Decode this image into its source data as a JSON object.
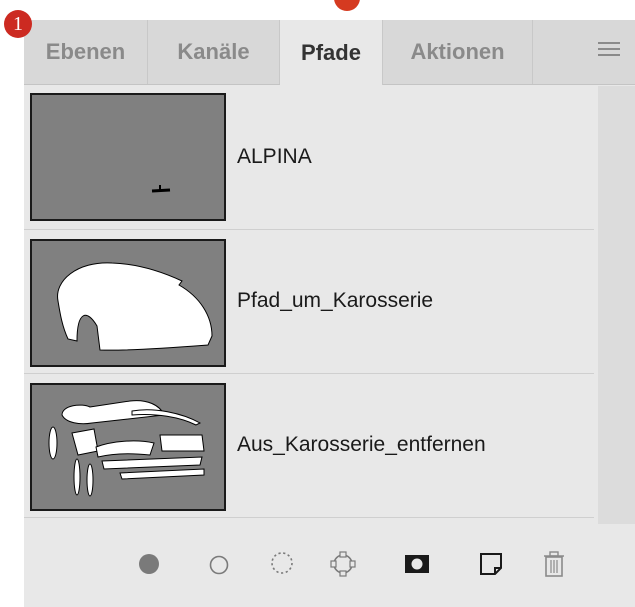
{
  "callout_number": "1",
  "tabs": [
    {
      "label": "Ebenen",
      "active": false
    },
    {
      "label": "Kanäle",
      "active": false
    },
    {
      "label": "Pfade",
      "active": true
    },
    {
      "label": "Aktionen",
      "active": false
    }
  ],
  "paths": [
    {
      "name": "ALPINA"
    },
    {
      "name": "Pfad_um_Karosserie"
    },
    {
      "name": "Aus_Karosserie_entfernen"
    }
  ],
  "footer_icons": [
    "fill-path-icon",
    "stroke-path-icon",
    "load-selection-icon",
    "make-work-path-icon",
    "add-mask-icon",
    "new-path-icon",
    "delete-path-icon"
  ],
  "colors": {
    "callout": "#cc2a21",
    "panel_bg": "#e8e8e8",
    "tab_bar_bg": "#d8d8d8",
    "thumbnail_bg": "#808080"
  }
}
